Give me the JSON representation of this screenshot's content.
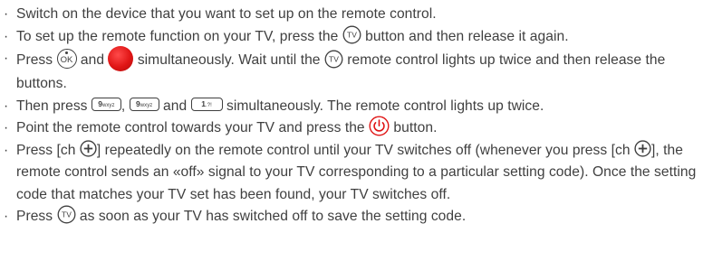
{
  "colors": {
    "text": "#3f3f3f",
    "red_button": "#e01515"
  },
  "icons": {
    "tv": "tv-button-icon",
    "ok": "ok-button-icon",
    "red": "red-button-icon",
    "nine": "key-9-wxyz-icon",
    "one": "key-1-icon",
    "power": "power-button-icon",
    "plus": "channel-plus-icon"
  },
  "bullet": "·",
  "keys": {
    "tv_label": "TV",
    "ok_label": "OK",
    "nine_digit": "9",
    "nine_letters": "wxyz",
    "one_digit": "1",
    "one_symbols": ".?!"
  },
  "steps": {
    "s1": {
      "text": "Switch on the device that you want to set up on the remote control."
    },
    "s2": {
      "a": "To set up the remote function on your TV, press the ",
      "b": " button and then release it again."
    },
    "s3": {
      "a": "Press ",
      "b": " and ",
      "c": " simultaneously. Wait until the ",
      "d": " remote control lights up twice and then release the buttons."
    },
    "s4": {
      "a": "Then press ",
      "b": ", ",
      "c": " and ",
      "d": " simultaneously. The remote control lights up twice."
    },
    "s5": {
      "a": "Point the remote control towards your TV and press the ",
      "b": " button."
    },
    "s6": {
      "a": "Press [ch ",
      "b": "] repeatedly on the remote control until your TV switches off (whenever you press [ch ",
      "c": "], the remote control sends an «off» signal to your TV corresponding to a particular setting code). Once the setting code that matches your TV set has been found, your TV switches off."
    },
    "s7": {
      "a": "Press ",
      "b": " as soon as your TV has switched off to save the setting code."
    }
  }
}
